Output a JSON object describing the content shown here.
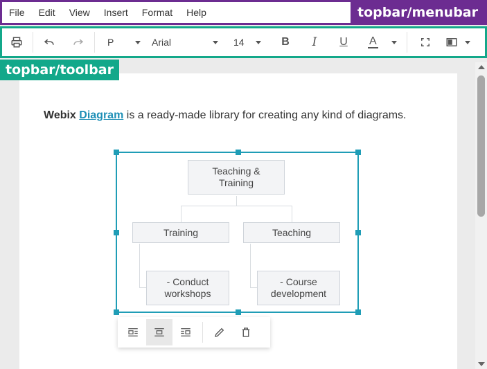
{
  "menubar": {
    "items": [
      "File",
      "Edit",
      "View",
      "Insert",
      "Format",
      "Help"
    ],
    "tag": "topbar/menubar"
  },
  "toolbar": {
    "tag": "topbar/toolbar",
    "paragraph_style": "P",
    "font_family": "Arial",
    "font_size": "14",
    "bold_label": "B",
    "italic_label": "I",
    "underline_label": "U",
    "font_color_label": "A",
    "icons": [
      "print-icon",
      "undo-icon",
      "redo-icon",
      "bold-icon",
      "italic-icon",
      "underline-icon",
      "font-color-icon",
      "fullscreen-icon",
      "layout-icon"
    ]
  },
  "content": {
    "para_prefix": "Webix",
    "para_link": "Diagram",
    "para_suffix": " is a ready-made library for creating any kind of diagrams."
  },
  "diagram": {
    "root": "Teaching & Training",
    "left": "Training",
    "right": "Teaching",
    "left_child": "- Conduct workshops",
    "right_child": "- Course development"
  },
  "image_toolbar": {
    "icons": [
      "align-left-icon",
      "align-center-icon",
      "align-right-icon",
      "edit-icon",
      "delete-icon"
    ],
    "active": "align-center-icon"
  },
  "colors": {
    "menubar_tag": "#6c2c91",
    "toolbar_tag": "#13a88a",
    "selection": "#1f9db6",
    "link": "#1e8fb6"
  }
}
